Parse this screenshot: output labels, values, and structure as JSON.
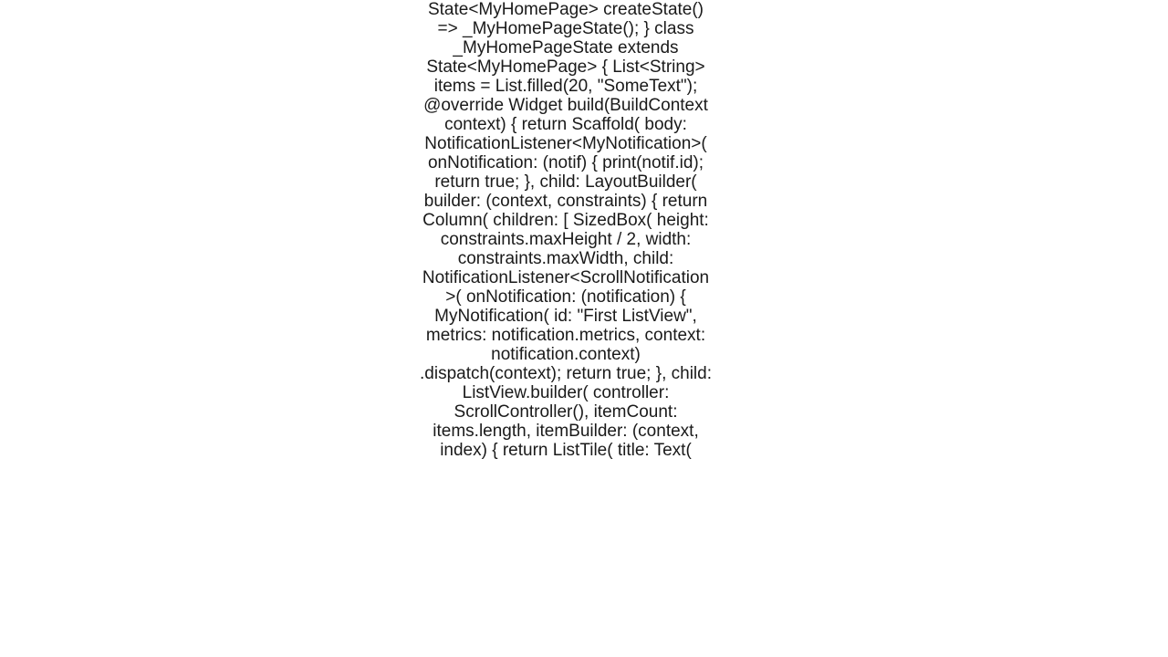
{
  "code": {
    "text": "State<MyHomePage> createState() => _MyHomePageState(); }  class _MyHomePageState extends State<MyHomePage> {    List<String> items = List.filled(20, \"SomeText\");    @override   Widget build(BuildContext context) {     return Scaffold(       body: NotificationListener<MyNotification>(         onNotification: (notif) {           print(notif.id);           return true;         },         child: LayoutBuilder(           builder: (context, constraints) {             return Column(               children: [                 SizedBox(                   height: constraints.maxHeight / 2,                   width: constraints.maxWidth,                   child: NotificationListener<ScrollNotification>(                     onNotification: (notification) {                       MyNotification(                               id: \"First ListView\",                               metrics: notification.metrics,                               context: notification.context)                           .dispatch(context);                       return true;                     },                     child: ListView.builder(                       controller: ScrollController(),                       itemCount: items.length,                       itemBuilder: (context, index) {                         return ListTile(                           title: Text("
  }
}
